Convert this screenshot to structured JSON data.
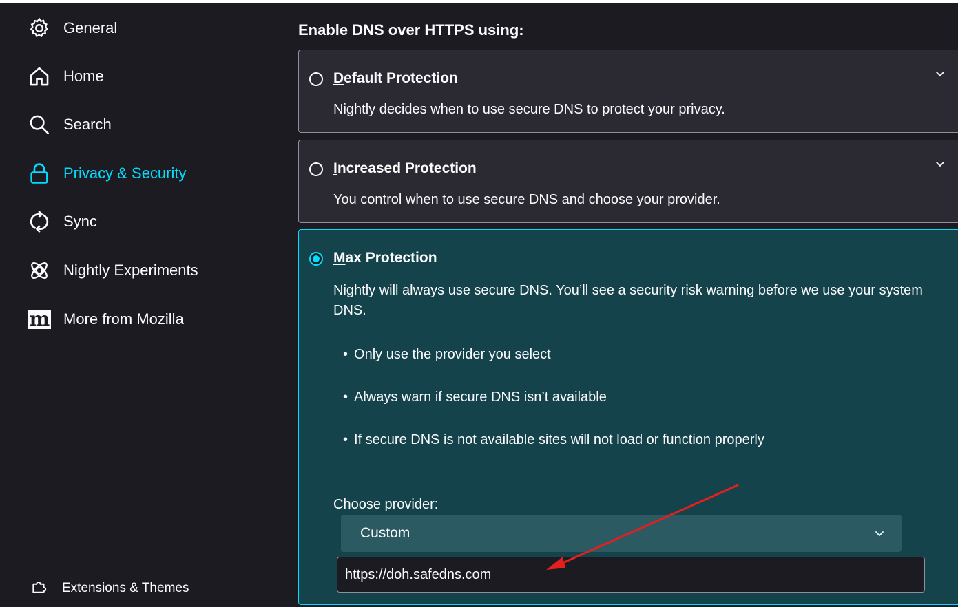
{
  "sidebar": {
    "items": [
      {
        "label": "General",
        "icon": "gear-icon"
      },
      {
        "label": "Home",
        "icon": "home-icon"
      },
      {
        "label": "Search",
        "icon": "search-icon"
      },
      {
        "label": "Privacy & Security",
        "icon": "lock-icon",
        "active": true
      },
      {
        "label": "Sync",
        "icon": "sync-icon"
      },
      {
        "label": "Nightly Experiments",
        "icon": "experiments-icon"
      },
      {
        "label": "More from Mozilla",
        "icon": "mozilla-m-icon",
        "icon_text": "m"
      }
    ],
    "footer": {
      "label": "Extensions & Themes",
      "icon": "puzzle-icon"
    }
  },
  "main": {
    "heading": "Enable DNS over HTTPS using:",
    "options": [
      {
        "title_key": "D",
        "title_rest": "efault Protection",
        "description": "Nightly decides when to use secure DNS to protect your privacy.",
        "selected": false
      },
      {
        "title_key": "I",
        "title_rest": "ncreased Protection",
        "description": "You control when to use secure DNS and choose your provider.",
        "selected": false
      },
      {
        "title_key": "M",
        "title_rest": "ax Protection",
        "description": "Nightly will always use secure DNS. You’ll see a security risk warning before we use your system DNS.",
        "selected": true,
        "bullets": [
          "Only use the provider you select",
          "Always warn if secure DNS isn’t available",
          "If secure DNS is not available sites will not load or function properly"
        ]
      }
    ],
    "provider": {
      "label": "Choose provider:",
      "selected": "Custom",
      "custom_url": "https://doh.safedns.com"
    }
  },
  "colors": {
    "background": "#1c1b22",
    "card": "#2b2a33",
    "selected_card": "#15434c",
    "accent": "#00ddff",
    "annotation_arrow": "#e51f1f"
  }
}
